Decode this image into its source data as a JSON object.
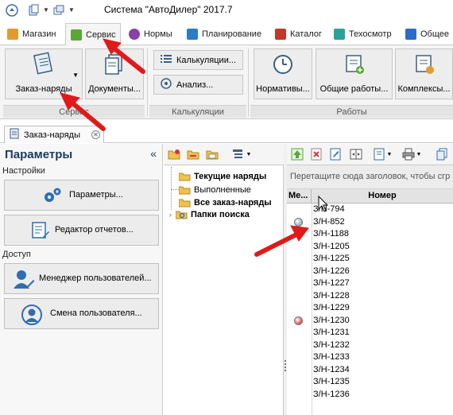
{
  "app": {
    "title": "Система \"АвтоДилер\" 2017.7"
  },
  "tabs": [
    {
      "label": "Магазин",
      "color": "#e69a2e"
    },
    {
      "label": "Сервис",
      "color": "#5aa832",
      "active": true
    },
    {
      "label": "Нормы",
      "color": "#8b3fa8"
    },
    {
      "label": "Планирование",
      "color": "#2a7cc7"
    },
    {
      "label": "Каталог",
      "color": "#c0392b"
    },
    {
      "label": "Техосмотр",
      "color": "#2aa19a"
    },
    {
      "label": "Общее",
      "color": "#2a6cc7"
    }
  ],
  "ribbon": {
    "zakaz_label": "Заказ-наряды",
    "documents_label": "Документы...",
    "calculations_label": "Калькуляции...",
    "analysis_label": "Анализ...",
    "normatives_label": "Нормативы...",
    "common_works_label": "Общие работы...",
    "complexes_label": "Комплексы...",
    "group_service": "Сервис",
    "group_calculations": "Калькуляции",
    "group_works": "Работы"
  },
  "doc_tab": {
    "label": "Заказ-наряды"
  },
  "left_panel": {
    "title": "Параметры",
    "collapse": "«",
    "section_settings": "Настройки",
    "params_button": "Параметры...",
    "report_editor_button": "Редактор отчетов...",
    "section_access": "Доступ",
    "user_manager_button": "Менеджер пользователей...",
    "change_user_button": "Смена пользователя..."
  },
  "tree": {
    "items": [
      {
        "label": "Текущие наряды",
        "bold": true
      },
      {
        "label": "Выполненные",
        "bold": false
      },
      {
        "label": "Все заказ-наряды",
        "bold": true
      },
      {
        "label": "Папки поиска",
        "bold": true
      }
    ]
  },
  "grid": {
    "group_hint": "Перетащите сюда заголовок, чтобы сгр",
    "col_mark": "Ме...",
    "col_number": "Номер",
    "rows": [
      {
        "number": "З/Н-794",
        "mark": ""
      },
      {
        "number": "З/Н-852",
        "mark": "gray"
      },
      {
        "number": "З/Н-1188",
        "mark": ""
      },
      {
        "number": "З/Н-1205",
        "mark": ""
      },
      {
        "number": "З/Н-1225",
        "mark": ""
      },
      {
        "number": "З/Н-1226",
        "mark": ""
      },
      {
        "number": "З/Н-1227",
        "mark": ""
      },
      {
        "number": "З/Н-1228",
        "mark": ""
      },
      {
        "number": "З/Н-1229",
        "mark": ""
      },
      {
        "number": "З/Н-1230",
        "mark": "red"
      },
      {
        "number": "З/Н-1231",
        "mark": ""
      },
      {
        "number": "З/Н-1232",
        "mark": ""
      },
      {
        "number": "З/Н-1233",
        "mark": ""
      },
      {
        "number": "З/Н-1234",
        "mark": ""
      },
      {
        "number": "З/Н-1235",
        "mark": ""
      },
      {
        "number": "З/Н-1236",
        "mark": ""
      }
    ]
  },
  "colors": {
    "arrow": "#e01a1a",
    "accent": "#1b3a5c"
  }
}
